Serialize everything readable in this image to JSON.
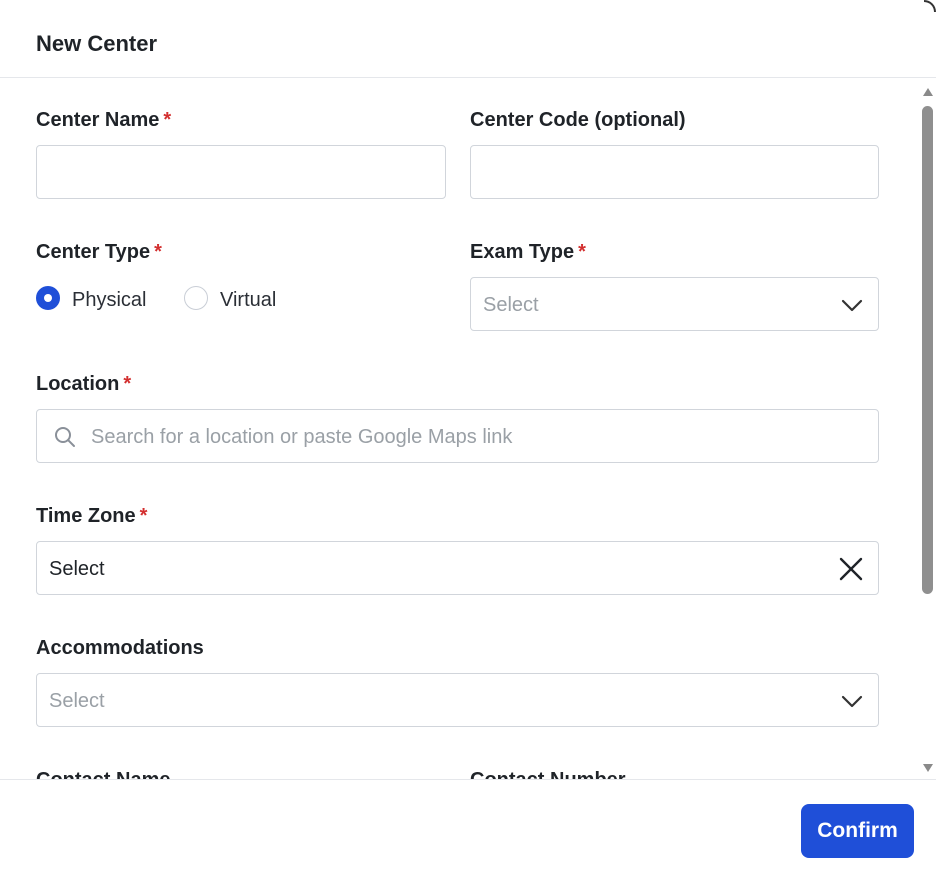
{
  "dialog": {
    "title": "New Center"
  },
  "form": {
    "center_name": {
      "label": "Center Name",
      "required_mark": "*",
      "value": ""
    },
    "center_code": {
      "label": "Center Code (optional)",
      "value": ""
    },
    "center_type": {
      "label": "Center Type",
      "required_mark": "*",
      "options": [
        {
          "label": "Physical",
          "selected": true
        },
        {
          "label": "Virtual",
          "selected": false
        }
      ]
    },
    "exam_type": {
      "label": "Exam Type",
      "required_mark": "*",
      "placeholder": "Select",
      "icon": "chevron-down-icon"
    },
    "location": {
      "label": "Location",
      "required_mark": "*",
      "placeholder": "Search for a location or paste Google Maps link",
      "icon": "search-icon"
    },
    "time_zone": {
      "label": "Time Zone",
      "required_mark": "*",
      "value": "Select",
      "icon": "close-icon"
    },
    "accommodations": {
      "label": "Accommodations",
      "placeholder": "Select",
      "icon": "chevron-down-icon"
    },
    "contact_name": {
      "label": "Contact Name"
    },
    "contact_number": {
      "label": "Contact Number"
    }
  },
  "footer": {
    "confirm_label": "Confirm"
  },
  "colors": {
    "accent": "#1f4fd8",
    "required": "#d32f2f",
    "border": "#d1d5db",
    "placeholder": "#9aa0a6"
  }
}
